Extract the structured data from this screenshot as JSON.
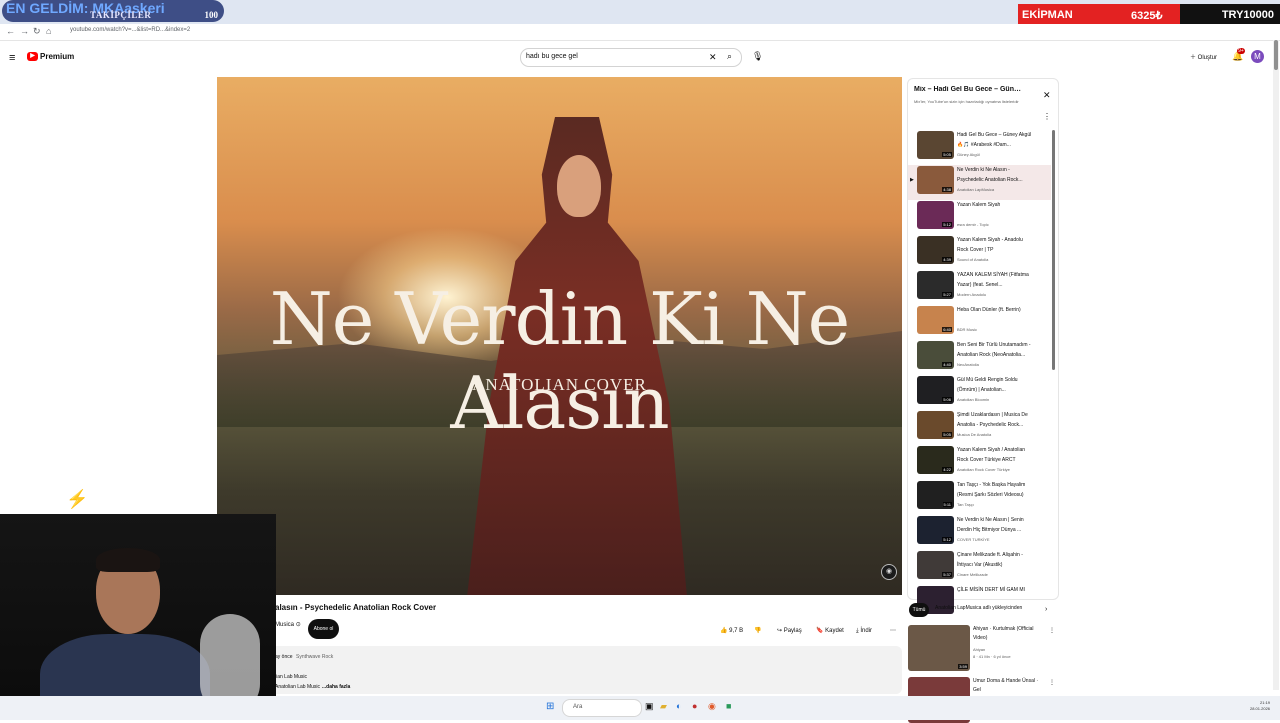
{
  "overlay": {
    "ticker": "EN GELDİM: MKAaskeri",
    "title": "TAKİPÇİLER",
    "count": "100"
  },
  "equipment": {
    "label": "EKİPMAN",
    "value": "6325₺",
    "try_label": "TRY10000"
  },
  "browser": {
    "url": "youtube.com/watch?v=...&list=RD...&index=2"
  },
  "header": {
    "logo_text": "Premium",
    "search_value": "hadı bu gece gel",
    "create_label": "Oluştur",
    "notification_count": "9+",
    "avatar_letter": "M"
  },
  "video": {
    "overlay_title": "Ne Verdin Ki Ne Alasın",
    "overlay_subtitle": "ANATOLIAN COVER",
    "title": "alasın - Psychedelic Anatolian Rock Cover",
    "channel": "Musica",
    "subscribe_label": "Abone ol",
    "actions": {
      "likes": "9,7 B",
      "share": "Paylaş",
      "save": "Kaydet",
      "download": "İndir"
    },
    "description": {
      "line1_a": "ay önce",
      "line1_b": "Synthwave Rock",
      "line2": "lian Lab Music",
      "line3": "Anatolian Lab Music",
      "more": "...daha fazla"
    }
  },
  "playlist": {
    "title": "Mix – Hadi Gel Bu Gece – Güney...",
    "subtitle": "Mix'ler, YouTube'un sizin için hazırladığı oynatma listeleridir",
    "items": [
      {
        "title": "Hadi Gel Bu Gece – Güney Akgül 🔥🎵 #Arabesk #Dam...",
        "channel": "Güney Akgül",
        "duration": "5:05",
        "color": "#5a4632"
      },
      {
        "title": "Ne Verdin ki Ne Alasın - Psychedelic Anatolian Rock...",
        "channel": "Anatolian LapMusica",
        "duration": "4:38",
        "color": "#8a5a3c"
      },
      {
        "title": "Yazan Kalem Siyah",
        "channel": "esra demir - Topic",
        "duration": "5:12",
        "color": "#6b2a57"
      },
      {
        "title": "Yazan Kalem Siyah - Anadolu Rock Cover | TP",
        "channel": "Sound of Anatolia",
        "duration": "4:39",
        "color": "#3a3024"
      },
      {
        "title": "YAZAN KALEM SİYAH (Fitfatma Yazar) (feat. Senel...",
        "channel": "Modern Anadolu",
        "duration": "5:27",
        "color": "#2b2b2b"
      },
      {
        "title": "Heba Olan Dünler (ft. Berrin)",
        "channel": "BDR Music",
        "duration": "6:40",
        "color": "#c7834d"
      },
      {
        "title": "Ben Seni Bir Türlü Unutamadım - Anatolian Rock (NeoAnatolia...",
        "channel": "NeoAnatolia",
        "duration": "4:40",
        "color": "#4a4d3a"
      },
      {
        "title": "Gül Mü Geldi Rengin Soldu (Ömrüm) | Anatolian...",
        "channel": "Anatolian Bloomin",
        "duration": "5:06",
        "color": "#1f1f22"
      },
      {
        "title": "Şimdi Uzaklardasın | Musica De Anatolia - Psychedelic Rock...",
        "channel": "Musica De Anatolia",
        "duration": "5:05",
        "color": "#6a4a2c"
      },
      {
        "title": "Yazan Kalem Siyah / Anatolian Rock Cover Türkiye ARCT",
        "channel": "Anatolian Rock Cover Türkiye",
        "duration": "4:22",
        "color": "#2a2a1c"
      },
      {
        "title": "Tan Taşçı - Yok Başka Hayalim (Resmi Şarkı Sözleri Videosu)",
        "channel": "Tan Taşçı",
        "duration": "5:11",
        "color": "#202020"
      },
      {
        "title": "Ne Verdin ki Ne Alasın | Senin Derdin Hiç Bitmiyor Dünya ...",
        "channel": "COVER TURKİYE",
        "duration": "5:12",
        "color": "#1c2230"
      },
      {
        "title": "Çinare Melikzade ft. Alişahin - İhtiyacı Var (Akustik)",
        "channel": "Cinare Melikzade",
        "duration": "5:37",
        "color": "#403a38"
      },
      {
        "title": "ÇİLE MİSİN DERT Mİ GAM MI",
        "channel": "",
        "duration": "",
        "color": "#2c2030"
      }
    ]
  },
  "filters": {
    "all": "Tümü",
    "uploader": "Anatolian LapMusica adlı yükleyicinden"
  },
  "recommendations": [
    {
      "title": "Ahiyan · Kurtulmak (Official Video)",
      "channel": "Ahiyan",
      "meta": "8 · 41 Mn · 6 yıl önce",
      "duration": "3:59",
      "color": "#6b5847"
    },
    {
      "title": "Umur Doma & Hande Ünsal · Gel",
      "channel": "",
      "meta": "",
      "duration": "",
      "color": "#7a3a3a"
    }
  ],
  "taskbar": {
    "search_placeholder": "Ara",
    "time": "21:19",
    "date": "28.01.2026"
  }
}
